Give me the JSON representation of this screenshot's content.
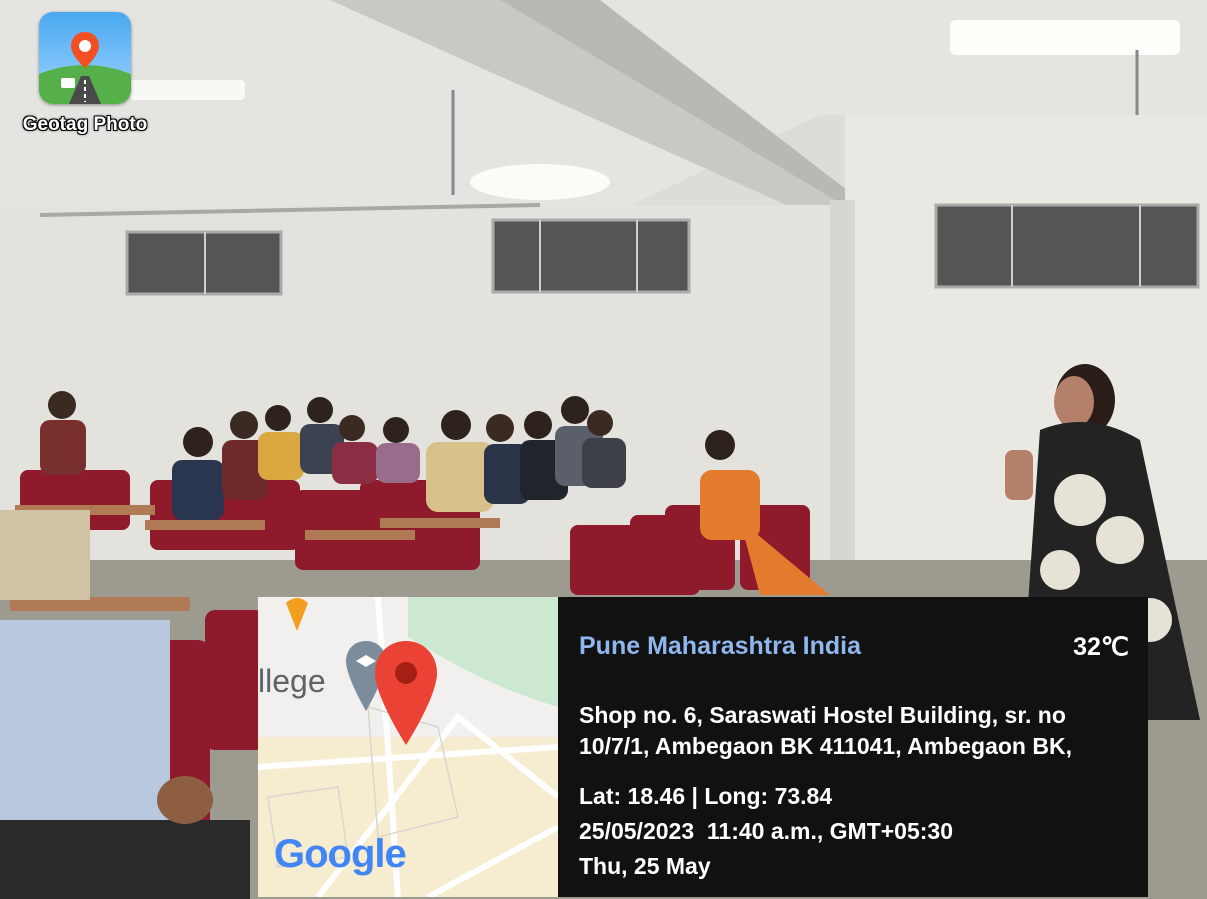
{
  "app_badge": {
    "label": "Geotag Photo",
    "icon": "geotag-photo-app-icon"
  },
  "map": {
    "place_label": "llege",
    "attribution": "Google",
    "pin_icon": "map-pin-icon",
    "place_icon": "school-place-icon",
    "colors": {
      "pin": "#ea4335",
      "park": "#cde8d0",
      "road": "#ffffff",
      "land": "#f1f0ee"
    }
  },
  "info": {
    "location": "Pune Maharashtra India",
    "temperature": "32℃",
    "address_line_1": "Shop no. 6, Saraswati Hostel Building, sr. no",
    "address_line_2": "10/7/1, Ambegaon BK 411041, Ambegaon BK,",
    "coordinates": "Lat: 18.46 | Long: 73.84",
    "datetime": "25/05/2023  11:40 a.m., GMT+05:30",
    "day": "Thu, 25 May",
    "colors": {
      "location": "#8fb7ee",
      "panel": "#111111",
      "text": "#ffffff"
    }
  }
}
